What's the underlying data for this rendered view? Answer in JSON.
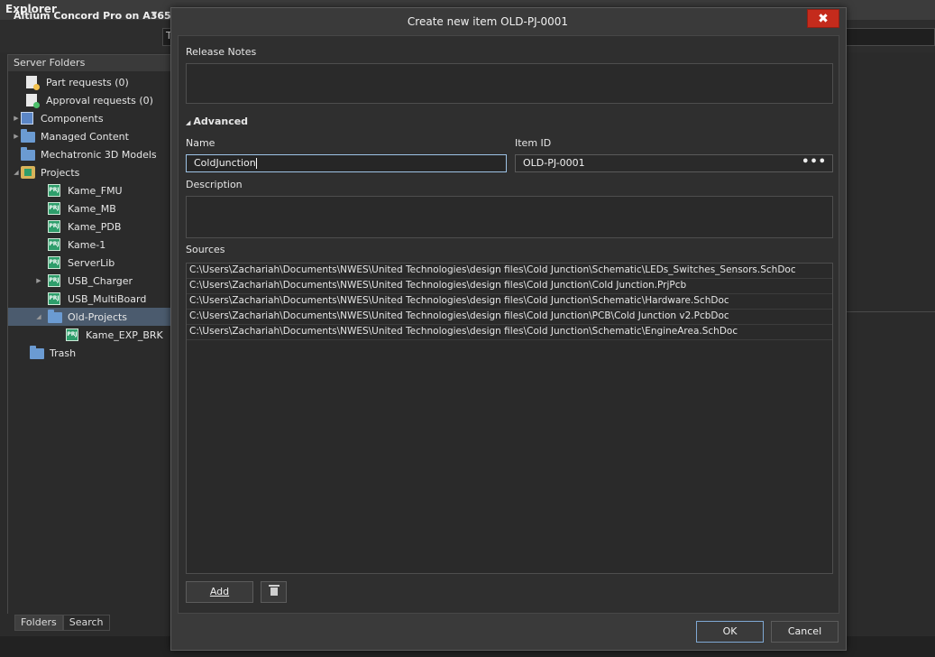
{
  "explorer": {
    "title": "Explorer",
    "server_name": "Altium Concord Pro on A365",
    "server_field": "T"
  },
  "folders_panel": {
    "header": "Server Folders",
    "items": [
      {
        "label": "Part requests (0)",
        "icon": "part-request-icon"
      },
      {
        "label": "Approval requests (0)",
        "icon": "approval-request-icon"
      },
      {
        "label": "Components",
        "icon": "components-icon"
      },
      {
        "label": "Managed Content",
        "icon": "folder-icon"
      },
      {
        "label": "Mechatronic 3D Models",
        "icon": "folder-icon"
      },
      {
        "label": "Projects",
        "icon": "projects-icon"
      },
      {
        "label": "Kame_FMU",
        "icon": "project-icon"
      },
      {
        "label": "Kame_MB",
        "icon": "project-icon"
      },
      {
        "label": "Kame_PDB",
        "icon": "project-icon"
      },
      {
        "label": "Kame-1",
        "icon": "project-icon"
      },
      {
        "label": "ServerLib",
        "icon": "project-icon"
      },
      {
        "label": "USB_Charger",
        "icon": "project-icon"
      },
      {
        "label": "USB_MultiBoard",
        "icon": "project-icon"
      },
      {
        "label": "Old-Projects",
        "icon": "folder-icon"
      },
      {
        "label": "Kame_EXP_BRK",
        "icon": "project-icon"
      },
      {
        "label": "Trash",
        "icon": "folder-icon"
      }
    ],
    "tabs": [
      "Folders",
      "Search"
    ]
  },
  "dialog": {
    "title": "Create new item OLD-PJ-0001",
    "release_notes_label": "Release Notes",
    "advanced_label": "Advanced",
    "name_label": "Name",
    "name_value": "ColdJunction",
    "item_id_label": "Item ID",
    "item_id_value": "OLD-PJ-0001",
    "description_label": "Description",
    "sources_label": "Sources",
    "sources": [
      "C:\\Users\\Zachariah\\Documents\\NWES\\United Technologies\\design files\\Cold Junction\\Schematic\\LEDs_Switches_Sensors.SchDoc",
      "C:\\Users\\Zachariah\\Documents\\NWES\\United Technologies\\design files\\Cold Junction\\Cold Junction.PrjPcb",
      "C:\\Users\\Zachariah\\Documents\\NWES\\United Technologies\\design files\\Cold Junction\\Schematic\\Hardware.SchDoc",
      "C:\\Users\\Zachariah\\Documents\\NWES\\United Technologies\\design files\\Cold Junction\\PCB\\Cold Junction v2.PcbDoc",
      "C:\\Users\\Zachariah\\Documents\\NWES\\United Technologies\\design files\\Cold Junction\\Schematic\\EngineArea.SchDoc"
    ],
    "add_label": "Add",
    "ok_label": "OK",
    "cancel_label": "Cancel",
    "close_glyph": "✖",
    "advanced_glyph": "◢",
    "dots_glyph": "•••"
  }
}
